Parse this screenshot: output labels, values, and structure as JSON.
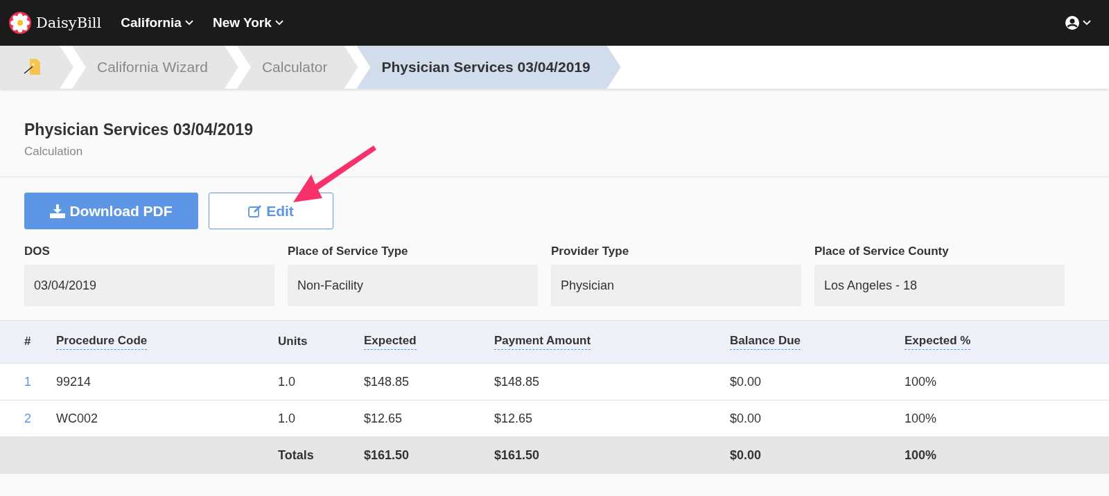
{
  "nav": {
    "brand": "DaisyBill",
    "menus": [
      {
        "label": "California"
      },
      {
        "label": "New York"
      }
    ]
  },
  "breadcrumbs": [
    {
      "kind": "home",
      "selected": false
    },
    {
      "kind": "text",
      "label": "California Wizard",
      "selected": false
    },
    {
      "kind": "text",
      "label": "Calculator",
      "selected": false
    },
    {
      "kind": "text",
      "label": "Physician Services 03/04/2019",
      "selected": true
    }
  ],
  "header": {
    "title": "Physician Services 03/04/2019",
    "subtitle": "Calculation"
  },
  "actions": [
    {
      "kind": "primary",
      "label": "Download PDF"
    },
    {
      "kind": "outline",
      "label": "Edit"
    }
  ],
  "fields": [
    {
      "label": "DOS",
      "value": "03/04/2019"
    },
    {
      "label": "Place of Service Type",
      "value": "Non-Facility"
    },
    {
      "label": "Provider Type",
      "value": "Physician"
    },
    {
      "label": "Place of Service County",
      "value": "Los Angeles - 18"
    }
  ],
  "table": {
    "columns": [
      {
        "label": "#",
        "has_tooltip": false
      },
      {
        "label": "Procedure Code",
        "has_tooltip": true
      },
      {
        "label": "Units",
        "has_tooltip": false
      },
      {
        "label": "Expected",
        "has_tooltip": true
      },
      {
        "label": "Payment Amount",
        "has_tooltip": true
      },
      {
        "label": "Balance Due",
        "has_tooltip": true
      },
      {
        "label": "Expected %",
        "has_tooltip": true
      }
    ],
    "rows": [
      [
        "1",
        "99214",
        "1.0",
        "$148.85",
        "$148.85",
        "$0.00",
        "100%"
      ],
      [
        "2",
        "WC002",
        "1.0",
        "$12.65",
        "$12.65",
        "$0.00",
        "100%"
      ]
    ],
    "totals": {
      "label": "Totals",
      "values": [
        "$161.50",
        "$161.50",
        "$0.00",
        "100%"
      ]
    }
  }
}
